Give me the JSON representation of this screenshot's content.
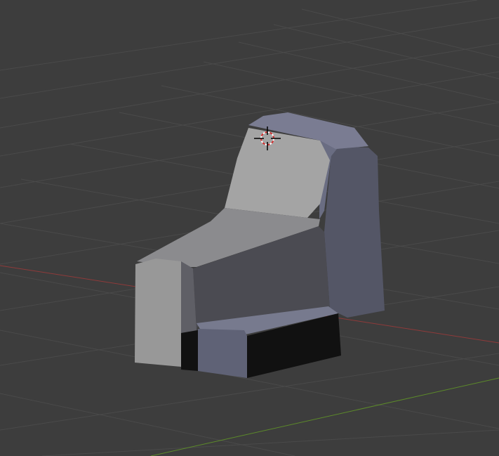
{
  "viewport": {
    "background": "#3d3d3d",
    "grid_color": "#4a4a4a",
    "x_axis_color": "#8f3a3a",
    "y_axis_color": "#5c8a2a"
  },
  "model": {
    "colors": {
      "front_light": "#9a9a9a",
      "top_light": "#a3a3a3",
      "side_blue": "#595b6e",
      "side_dark": "#4d4e5c",
      "front_dark": "#4a4a52",
      "footrest_blue": "#5f6276",
      "black": "#111111",
      "edge_highlight": "#6f7390"
    }
  },
  "cursor_icon": "3d-cursor-icon"
}
